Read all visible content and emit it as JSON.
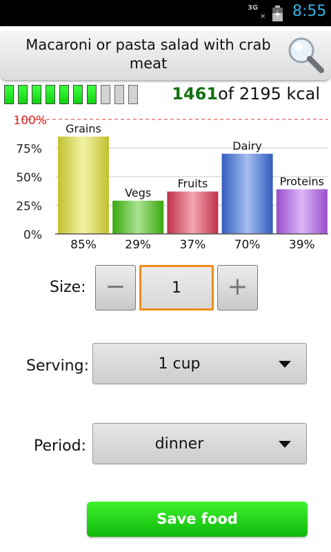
{
  "status": {
    "network": "3G",
    "time": "8:55"
  },
  "header": {
    "title": "Macaroni or pasta salad with crab meat"
  },
  "calories": {
    "consumed": "1461",
    "of_text": "of 2195 kcal",
    "filled_fraction": 0.7
  },
  "chart_data": {
    "type": "bar",
    "categories": [
      "Grains",
      "Vegs",
      "Fruits",
      "Dairy",
      "Proteins"
    ],
    "values": [
      85,
      29,
      37,
      70,
      39
    ],
    "value_labels": [
      "85%",
      "29%",
      "37%",
      "70%",
      "39%"
    ],
    "colors": [
      "#e3e33a",
      "#44c40f",
      "#e23a55",
      "#3a6de0",
      "#b45cf0"
    ],
    "yticks": [
      "0%",
      "25%",
      "50%",
      "75%",
      "100%"
    ],
    "ylim": [
      0,
      100
    ],
    "grid": true
  },
  "size": {
    "label": "Size:",
    "value": "1",
    "minus": "−",
    "plus": "+"
  },
  "serving": {
    "label": "Serving:",
    "value": "1 cup"
  },
  "period": {
    "label": "Period:",
    "value": "dinner"
  },
  "save_button": {
    "label": "Save food"
  }
}
